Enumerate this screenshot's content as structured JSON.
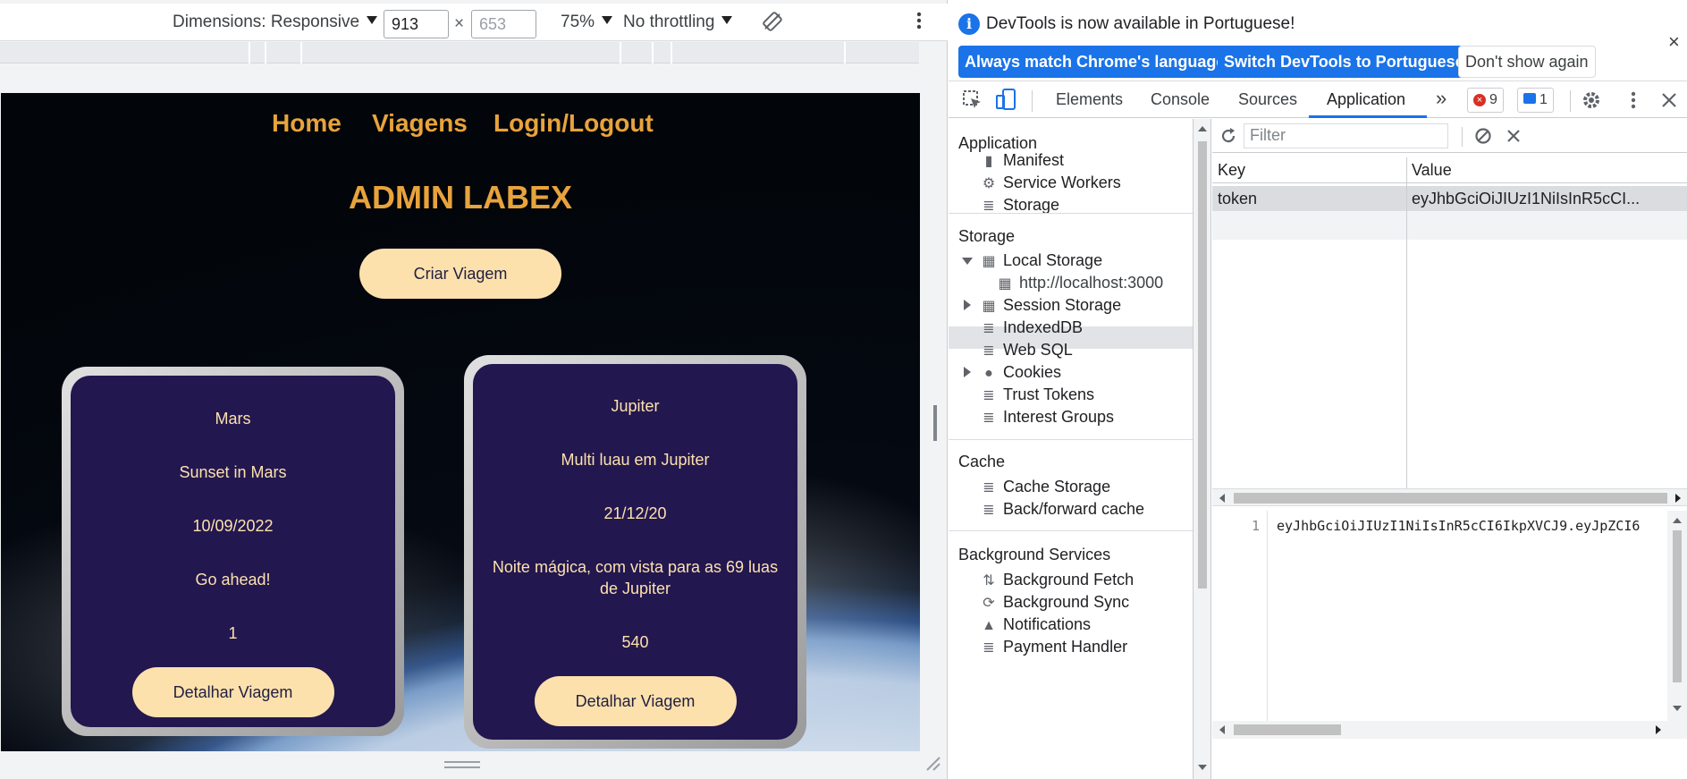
{
  "device_toolbar": {
    "dimensions_label": "Dimensions: Responsive",
    "width_value": "913",
    "times": "×",
    "height_value": "653",
    "zoom": "75%",
    "throttling": "No throttling"
  },
  "page": {
    "nav": [
      "Home",
      "Viagens",
      "Login/Logout"
    ],
    "title": "ADMIN LABEX",
    "create_button": "Criar Viagem",
    "trips": [
      {
        "planet": "Mars",
        "name": "Sunset in Mars",
        "date": "10/09/2022",
        "description": "Go ahead!",
        "duration": "1",
        "button": "Detalhar Viagem"
      },
      {
        "planet": "Jupiter",
        "name": "Multi luau em Jupiter",
        "date": "21/12/20",
        "description": "Noite mágica, com vista para as 69 luas de Jupiter",
        "duration": "540",
        "button": "Detalhar Viagem"
      }
    ]
  },
  "devtools": {
    "infobar": {
      "message": "DevTools is now available in Portuguese!",
      "btn_match": "Always match Chrome's language",
      "btn_switch": "Switch DevTools to Portuguese",
      "btn_dismiss": "Don't show again",
      "close": "×"
    },
    "tabs": [
      "Elements",
      "Console",
      "Sources",
      "Application"
    ],
    "more_tabs": "»",
    "errors_count": "9",
    "messages_count": "1",
    "sidebar": {
      "application": {
        "heading": "Application",
        "items": [
          "Manifest",
          "Service Workers",
          "Storage"
        ]
      },
      "storage": {
        "heading": "Storage",
        "local_storage": "Local Storage",
        "origin": "http://localhost:3000",
        "items": [
          "Session Storage",
          "IndexedDB",
          "Web SQL",
          "Cookies",
          "Trust Tokens",
          "Interest Groups"
        ]
      },
      "cache": {
        "heading": "Cache",
        "items": [
          "Cache Storage",
          "Back/forward cache"
        ]
      },
      "background": {
        "heading": "Background Services",
        "items": [
          "Background Fetch",
          "Background Sync",
          "Notifications",
          "Payment Handler"
        ]
      }
    },
    "storage_panel": {
      "filter_placeholder": "Filter",
      "columns": [
        "Key",
        "Value"
      ],
      "rows": [
        {
          "key": "token",
          "value": "eyJhbGciOiJIUzI1NiIsInR5cCI..."
        }
      ],
      "preview_line_number": "1",
      "preview_text": "eyJhbGciOiJIUzI1NiIsInR5cCI6IkpXVCJ9.eyJpZCI6"
    }
  },
  "colors": {
    "accent_orange": "#e8a33c",
    "card_bg": "#22174f",
    "pill_bg": "#fde1ad",
    "devtools_blue": "#1a73e8"
  }
}
